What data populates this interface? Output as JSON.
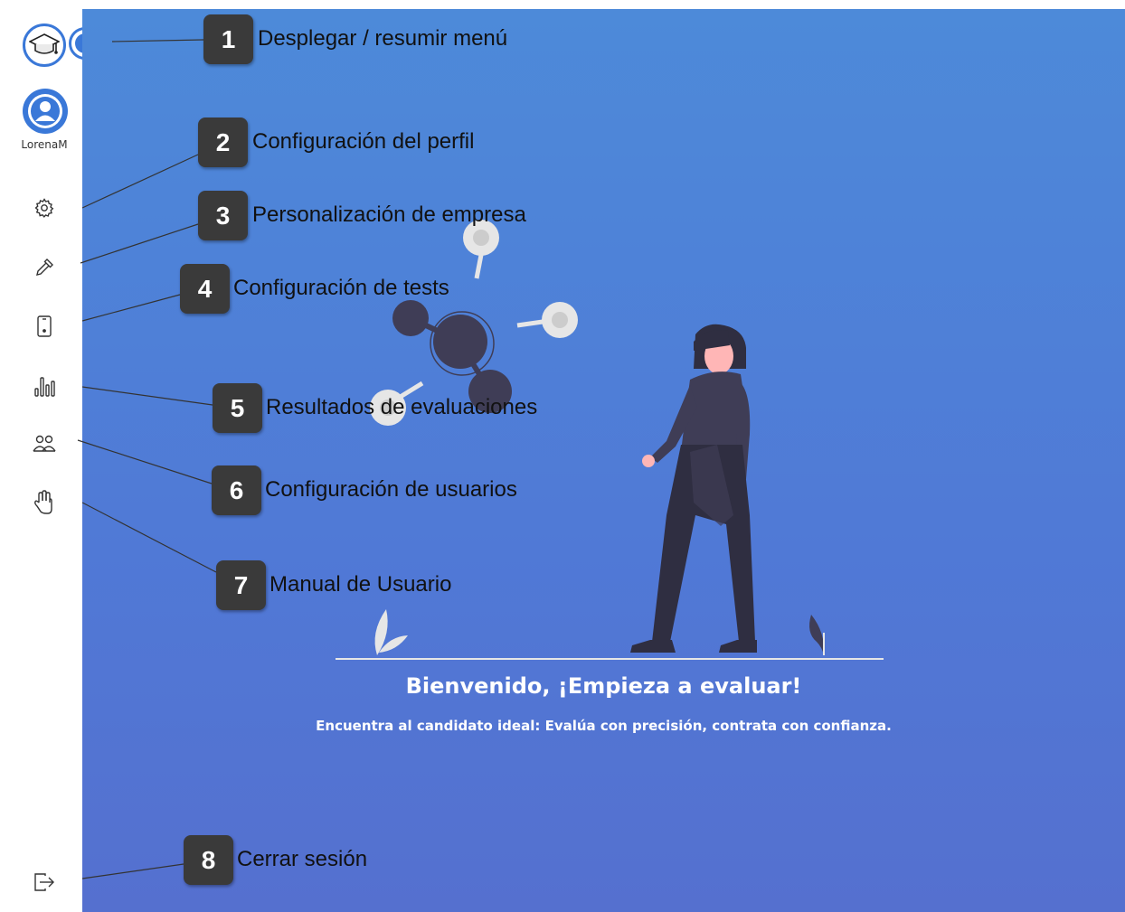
{
  "sidebar": {
    "username": "LorenaM",
    "logo_icon": "graduation-cap-icon",
    "toggle_icon": "play-circle-icon",
    "items": [
      {
        "id": "profile",
        "icon": "user-avatar-icon"
      },
      {
        "id": "settings",
        "icon": "gear-icon"
      },
      {
        "id": "company",
        "icon": "eyedropper-icon"
      },
      {
        "id": "tests",
        "icon": "tablet-icon"
      },
      {
        "id": "results",
        "icon": "bar-chart-icon"
      },
      {
        "id": "users",
        "icon": "users-icon"
      },
      {
        "id": "manual",
        "icon": "hand-icon"
      },
      {
        "id": "logout",
        "icon": "logout-icon"
      }
    ]
  },
  "callouts": [
    {
      "number": "1",
      "label": "Desplegar / resumir menú"
    },
    {
      "number": "2",
      "label": "Configuración del perfil"
    },
    {
      "number": "3",
      "label": "Personalización de empresa"
    },
    {
      "number": "4",
      "label": "Configuración de tests"
    },
    {
      "number": "5",
      "label": "Resultados de evaluaciones"
    },
    {
      "number": "6",
      "label": "Configuración de usuarios"
    },
    {
      "number": "7",
      "label": "Manual de Usuario"
    },
    {
      "number": "8",
      "label": "Cerrar sesión"
    }
  ],
  "main": {
    "title": "Bienvenido, ¡Empieza a evaluar!",
    "subtitle": "Encuentra al candidato ideal: Evalúa con precisión, contrata con confianza."
  },
  "colors": {
    "accent": "#3a78d8",
    "background_top": "#4d8ad9",
    "background_bottom": "#5570cf",
    "badge": "#3a3a3a"
  }
}
